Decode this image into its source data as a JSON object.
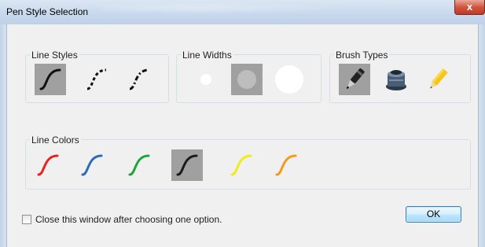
{
  "window": {
    "title": "Pen Style Selection",
    "close_glyph": "x"
  },
  "line_styles": {
    "label": "Line Styles",
    "options": [
      {
        "name": "solid",
        "selected": true
      },
      {
        "name": "dashed",
        "selected": false
      },
      {
        "name": "dash-dot",
        "selected": false
      }
    ]
  },
  "line_widths": {
    "label": "Line Widths",
    "options": [
      {
        "name": "thin",
        "selected": false
      },
      {
        "name": "medium",
        "selected": true
      },
      {
        "name": "thick",
        "selected": false
      }
    ]
  },
  "brush_types": {
    "label": "Brush Types",
    "options": [
      {
        "name": "marker",
        "icon": "marker-pen-icon",
        "selected": true
      },
      {
        "name": "ink",
        "icon": "ink-stamp-icon",
        "selected": false
      },
      {
        "name": "pencil",
        "icon": "pencil-icon",
        "selected": false
      }
    ]
  },
  "line_colors": {
    "label": "Line Colors",
    "options": [
      {
        "name": "red",
        "color": "#e8231e",
        "selected": false
      },
      {
        "name": "blue",
        "color": "#2b6cb8",
        "selected": false
      },
      {
        "name": "green",
        "color": "#1ea43a",
        "selected": false
      },
      {
        "name": "black",
        "color": "#1a1a1a",
        "selected": true
      },
      {
        "name": "yellow",
        "color": "#f2ec16",
        "selected": false
      },
      {
        "name": "orange",
        "color": "#f39a1c",
        "selected": false
      }
    ]
  },
  "close_after_choose": {
    "label": "Close this window after choosing one option.",
    "checked": false
  },
  "ok_button": {
    "label": "OK"
  }
}
